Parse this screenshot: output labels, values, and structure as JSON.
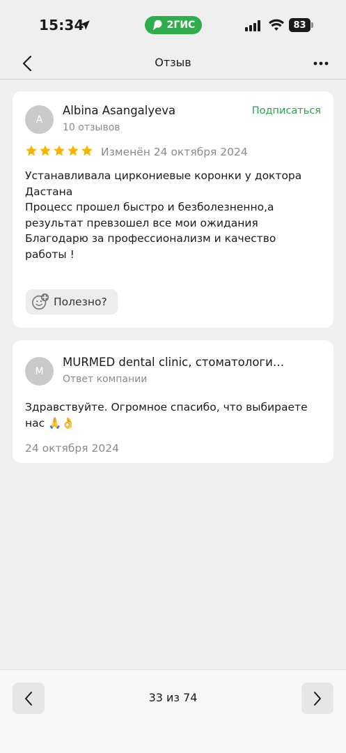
{
  "status_bar": {
    "time": "15:34",
    "app_badge": "2ГИС",
    "battery": "83"
  },
  "nav": {
    "title": "Отзыв"
  },
  "review": {
    "avatar_letter": "A",
    "author": "Albina Asangalyeva",
    "reviews_count": "10 отзывов",
    "subscribe_label": "Подписаться",
    "rating": 5,
    "edited": "Изменён 24 октября 2024",
    "text_lines": [
      "Устанавливала циркониевые коронки у доктора",
      "Дастана",
      "Процесс прошел быстро и безболезненно,а",
      "результат превзошел все мои ожидания",
      "Благодарю за профессионализм и качество",
      "работы !"
    ],
    "helpful_label": "Полезно?"
  },
  "reply": {
    "avatar_letter": "M",
    "company": "MURMED dental clinic, стоматологи…",
    "role": "Ответ компании",
    "text_line1": "Здравствуйте. Огромное спасибо, что выбираете",
    "text_line2": "нас 🙏👌",
    "date": "24 октября 2024"
  },
  "pager": {
    "label": "33 из 74"
  },
  "colors": {
    "accent_green": "#2aa14a",
    "star": "#f5b400",
    "badge_green": "#2fad4a"
  }
}
